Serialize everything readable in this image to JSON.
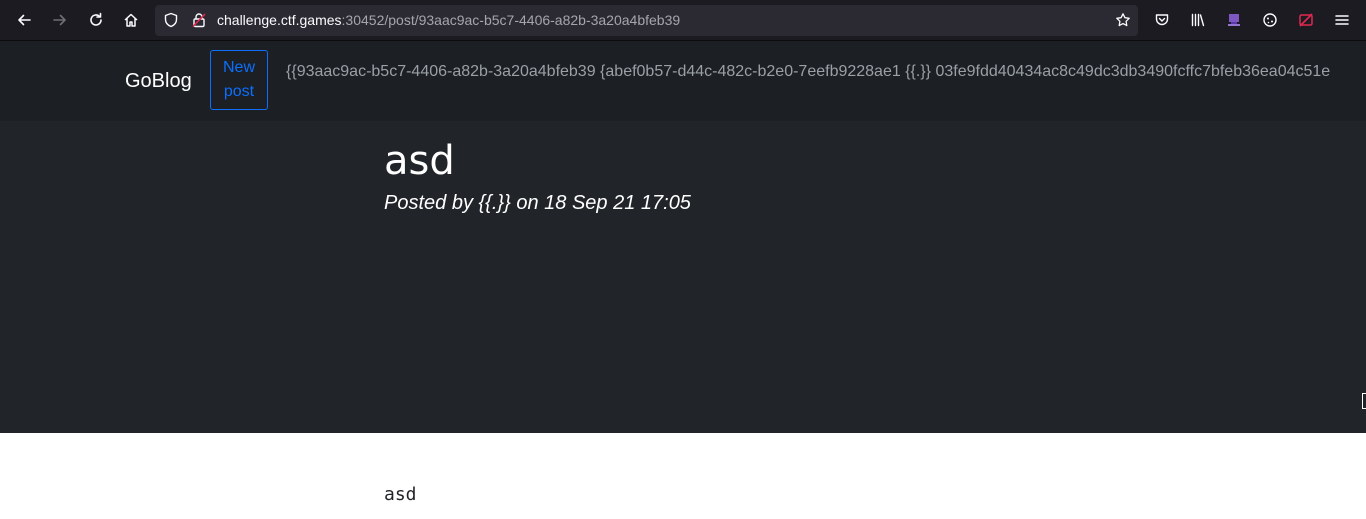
{
  "browser": {
    "url_host": "challenge.ctf.games",
    "url_rest": ":30452/post/93aac9ac-b5c7-4406-a82b-3a20a4bfeb39",
    "icons": [
      "back-icon",
      "forward-icon",
      "reload-icon",
      "home-icon",
      "shield-icon",
      "insecure-lock-icon",
      "bookmark-star-icon",
      "pocket-icon",
      "library-icon",
      "extension-icon",
      "cookie-icon",
      "blocked-icon",
      "menu-icon"
    ]
  },
  "navbar": {
    "brand": "GoBlog",
    "new_post_label": "New post",
    "leaked_text": "{{93aac9ac-b5c7-4406-a82b-3a20a4bfeb39 {abef0b57-d44c-482c-b2e0-7eefb9228ae1 {{.}} 03fe9fdd40434ac8c49dc3db3490fcffc7bfeb36ea04c51e"
  },
  "post": {
    "title": "asd",
    "meta": "Posted by {{.}} on 18 Sep 21 17:05",
    "body": "asd"
  },
  "colors": {
    "toolbar_bg": "#1c1b22",
    "urlbar_bg": "#2b2a33",
    "page_dark_bg": "#212529",
    "navbar_bg": "#1c1f23",
    "accent_blue": "#0d6efd"
  }
}
